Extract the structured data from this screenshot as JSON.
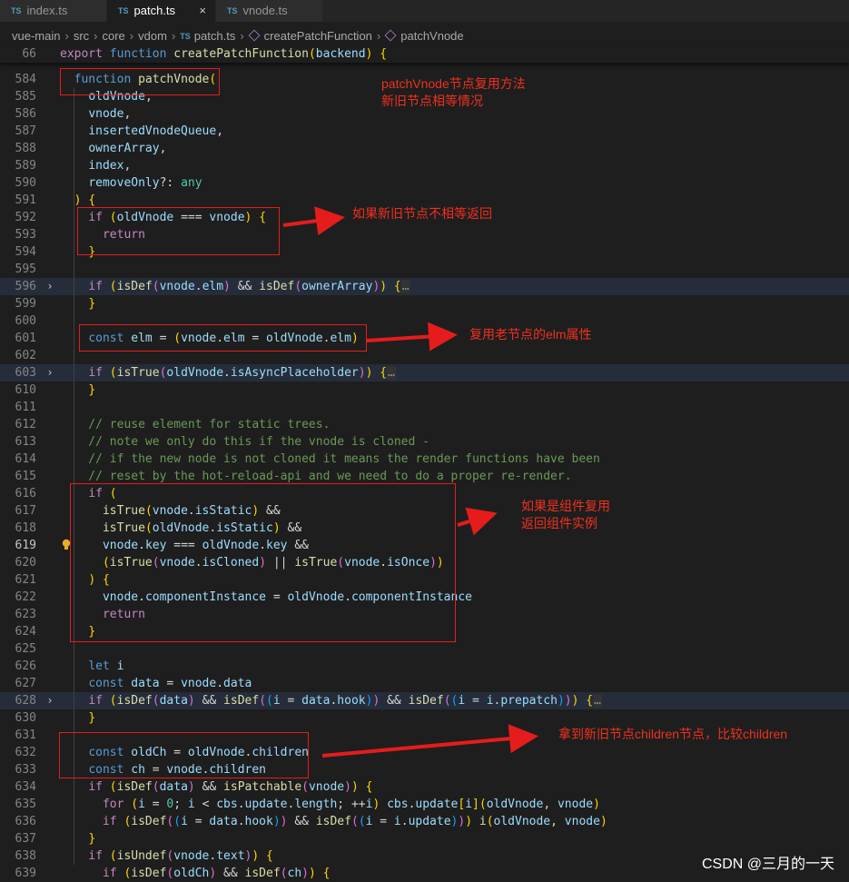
{
  "tabs": [
    {
      "badge": "TS",
      "label": "index.ts"
    },
    {
      "badge": "TS",
      "label": "patch.ts",
      "close": "×"
    },
    {
      "badge": "TS",
      "label": "vnode.ts"
    }
  ],
  "breadcrumb": {
    "parts": [
      "vue-main",
      "src",
      "core",
      "vdom"
    ],
    "file": "patch.ts",
    "symbols": [
      "createPatchFunction",
      "patchVnode"
    ]
  },
  "sticky_line": {
    "number": "66",
    "text": "export function createPatchFunction(backend) {"
  },
  "lines": [
    {
      "n": "584",
      "text": "  function patchVnode("
    },
    {
      "n": "585",
      "text": "    oldVnode,"
    },
    {
      "n": "586",
      "text": "    vnode,"
    },
    {
      "n": "587",
      "text": "    insertedVnodeQueue,"
    },
    {
      "n": "588",
      "text": "    ownerArray,"
    },
    {
      "n": "589",
      "text": "    index,"
    },
    {
      "n": "590",
      "text": "    removeOnly?: any"
    },
    {
      "n": "591",
      "text": "  ) {"
    },
    {
      "n": "592",
      "text": "    if (oldVnode === vnode) {"
    },
    {
      "n": "593",
      "text": "      return"
    },
    {
      "n": "594",
      "text": "    }"
    },
    {
      "n": "595",
      "text": ""
    },
    {
      "n": "596",
      "text": "    if (isDef(vnode.elm) && isDef(ownerArray)) {…"
    },
    {
      "n": "599",
      "text": "    }"
    },
    {
      "n": "600",
      "text": ""
    },
    {
      "n": "601",
      "text": "    const elm = (vnode.elm = oldVnode.elm)"
    },
    {
      "n": "602",
      "text": ""
    },
    {
      "n": "603",
      "text": "    if (isTrue(oldVnode.isAsyncPlaceholder)) {…"
    },
    {
      "n": "610",
      "text": "    }"
    },
    {
      "n": "611",
      "text": ""
    },
    {
      "n": "612",
      "text": "    // reuse element for static trees."
    },
    {
      "n": "613",
      "text": "    // note we only do this if the vnode is cloned -"
    },
    {
      "n": "614",
      "text": "    // if the new node is not cloned it means the render functions have been"
    },
    {
      "n": "615",
      "text": "    // reset by the hot-reload-api and we need to do a proper re-render."
    },
    {
      "n": "616",
      "text": "    if ("
    },
    {
      "n": "617",
      "text": "      isTrue(vnode.isStatic) &&"
    },
    {
      "n": "618",
      "text": "      isTrue(oldVnode.isStatic) &&"
    },
    {
      "n": "619",
      "text": "      vnode.key === oldVnode.key &&"
    },
    {
      "n": "620",
      "text": "      (isTrue(vnode.isCloned) || isTrue(vnode.isOnce))"
    },
    {
      "n": "621",
      "text": "    ) {"
    },
    {
      "n": "622",
      "text": "      vnode.componentInstance = oldVnode.componentInstance"
    },
    {
      "n": "623",
      "text": "      return"
    },
    {
      "n": "624",
      "text": "    }"
    },
    {
      "n": "625",
      "text": ""
    },
    {
      "n": "626",
      "text": "    let i"
    },
    {
      "n": "627",
      "text": "    const data = vnode.data"
    },
    {
      "n": "628",
      "text": "    if (isDef(data) && isDef((i = data.hook)) && isDef((i = i.prepatch))) {…"
    },
    {
      "n": "630",
      "text": "    }"
    },
    {
      "n": "631",
      "text": ""
    },
    {
      "n": "632",
      "text": "    const oldCh = oldVnode.children"
    },
    {
      "n": "633",
      "text": "    const ch = vnode.children"
    },
    {
      "n": "634",
      "text": "    if (isDef(data) && isPatchable(vnode)) {"
    },
    {
      "n": "635",
      "text": "      for (i = 0; i < cbs.update.length; ++i) cbs.update[i](oldVnode, vnode)"
    },
    {
      "n": "636",
      "text": "      if (isDef((i = data.hook)) && isDef((i = i.update))) i(oldVnode, vnode)"
    },
    {
      "n": "637",
      "text": "    }"
    },
    {
      "n": "638",
      "text": "    if (isUndef(vnode.text)) {"
    },
    {
      "n": "639",
      "text": "      if (isDef(oldCh) && isDef(ch)) {"
    }
  ],
  "annotations": {
    "a1_line1": "patchVnode节点复用方法",
    "a1_line2": "新旧节点相等情况",
    "a2": "如果新旧节点不相等返回",
    "a3": "复用老节点的elm属性",
    "a4_line1": "如果是组件复用",
    "a4_line2": "返回组件实例",
    "a5": "拿到新旧节点children节点，比较children"
  },
  "watermark": "CSDN @三月的一天",
  "colors": {
    "annotation": "#f0301e",
    "box": "#e51c1c",
    "background": "#1e1e1e"
  }
}
